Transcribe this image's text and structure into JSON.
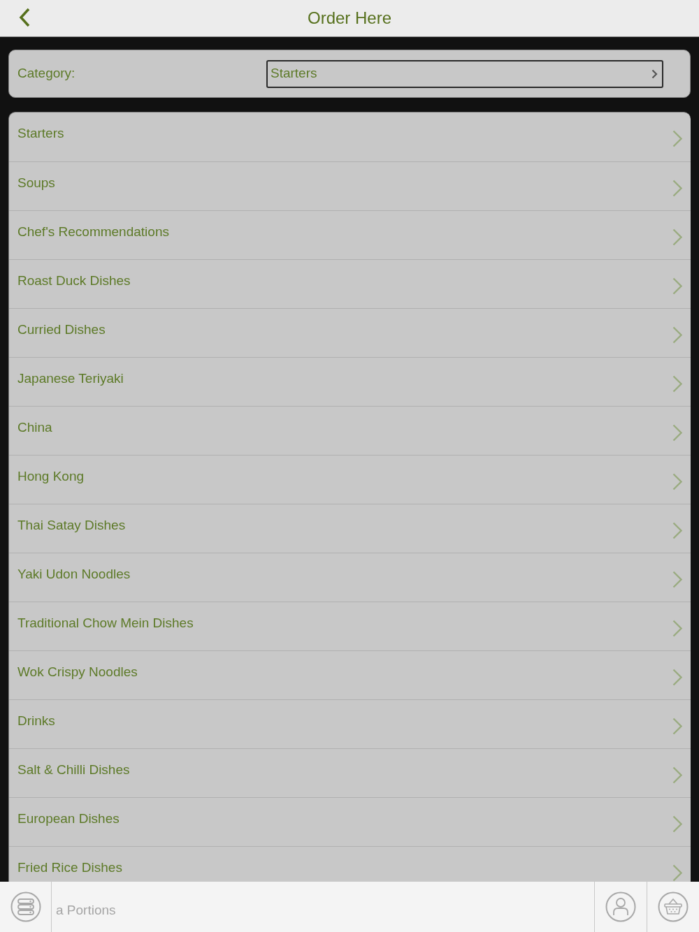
{
  "header": {
    "title": "Order Here"
  },
  "category": {
    "label": "Category:",
    "value": "Starters"
  },
  "categories": [
    "Starters",
    "Soups",
    "Chef's Recommendations",
    "Roast Duck Dishes",
    "Curried Dishes",
    "Japanese Teriyaki",
    "China",
    "Hong Kong",
    "Thai Satay Dishes",
    "Yaki Udon Noodles",
    "Traditional Chow Mein Dishes",
    "Wok Crispy Noodles",
    "Drinks",
    "Salt & Chilli Dishes",
    "European Dishes",
    "Fried Rice Dishes"
  ],
  "bottom_bar": {
    "label": "a Portions"
  }
}
